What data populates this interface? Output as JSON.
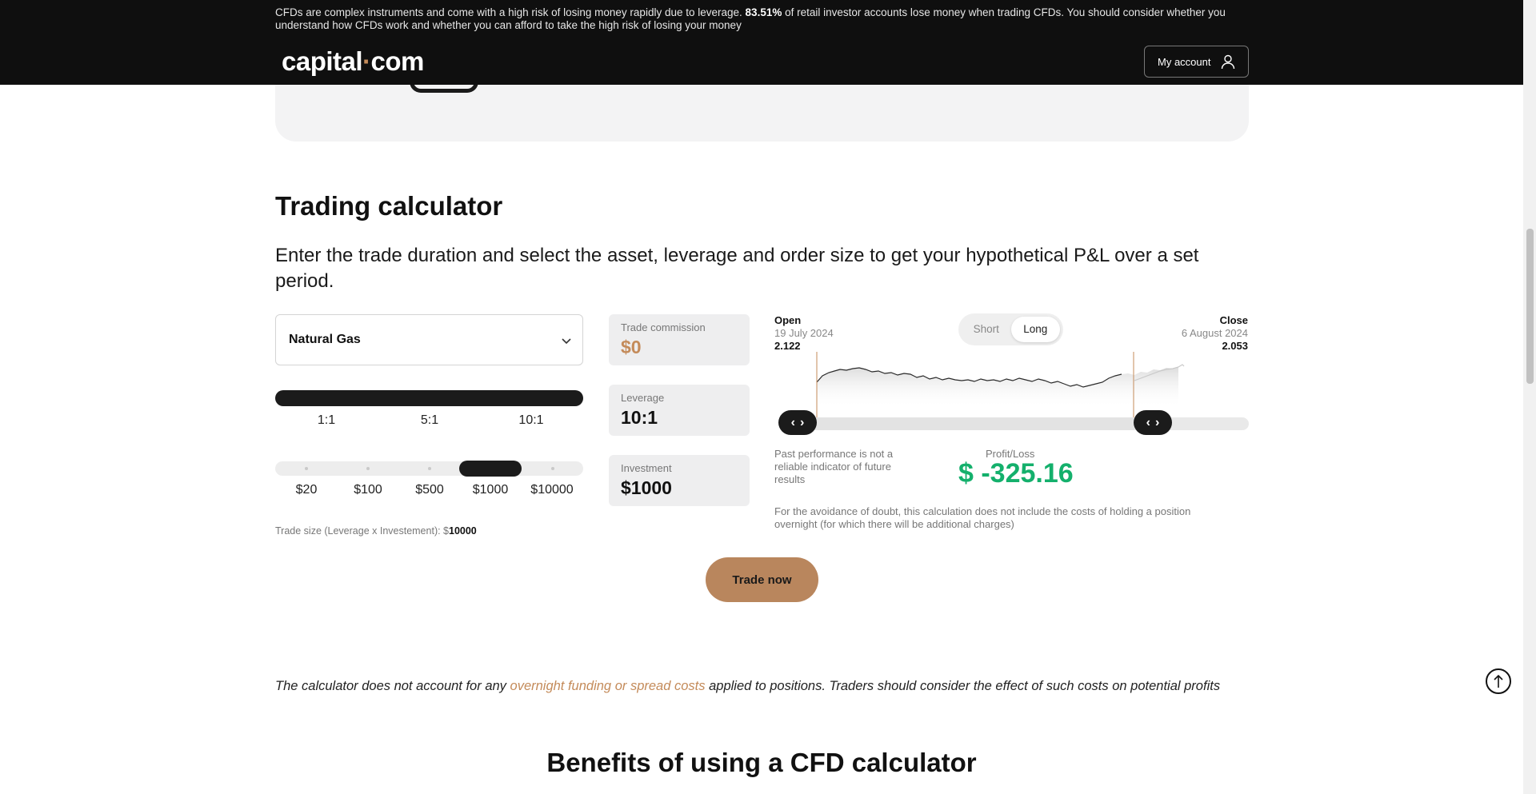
{
  "header": {
    "risk_prefix": "CFDs are complex instruments and come with a high risk of losing money rapidly due to leverage.",
    "risk_pct": "83.51%",
    "risk_suffix": "of retail investor accounts lose money when trading CFDs. You should consider whether you understand how CFDs work and whether you can afford to take the high risk of losing your money",
    "logo_left": "capital",
    "logo_dot": "·",
    "logo_right": "com",
    "my_account": "My account"
  },
  "section": {
    "title": "Trading calculator",
    "intro": "Enter the trade duration and select the asset, leverage and order size to get your hypothetical P&L over a set period."
  },
  "calculator": {
    "asset": "Natural Gas",
    "leverage_options": [
      "1:1",
      "5:1",
      "10:1"
    ],
    "leverage_selected": "10:1",
    "investment_options": [
      "$20",
      "$100",
      "$500",
      "$1000",
      "$10000"
    ],
    "investment_selected": "$1000",
    "trade_size_label": "Trade size (Leverage x Investement): $",
    "trade_size_value": "10000",
    "commission_label": "Trade commission",
    "commission_value": "$0",
    "leverage_label": "Leverage",
    "leverage_value": "10:1",
    "investment_label": "Investment",
    "investment_value": "$1000"
  },
  "chart": {
    "open_label": "Open",
    "open_date": "19 July 2024",
    "open_value": "2.122",
    "close_label": "Close",
    "close_date": "6 August 2024",
    "close_value": "2.053",
    "toggle_short": "Short",
    "toggle_long": "Long",
    "toggle_selected": "Long",
    "past_performance": "Past performance is not a reliable indicator of future results",
    "pl_label": "Profit/Loss",
    "pl_value": "$ -325.16",
    "doubt_note": "For the avoidance of doubt, this calculation does not include the costs of holding a position overnight (for which there will be additional charges)"
  },
  "cta": {
    "trade_now": "Trade now"
  },
  "footer_note": {
    "prefix": "The calculator does not account for any",
    "link": "overnight funding or spread costs",
    "suffix": "applied to positions. Traders should consider the effect of such costs on potential profits"
  },
  "next_section_title": "Benefits of using a CFD calculator",
  "colors": {
    "accent": "#c48b5a",
    "profit": "#14b06c",
    "button": "#b9865d",
    "dark": "#1b1b1b"
  }
}
